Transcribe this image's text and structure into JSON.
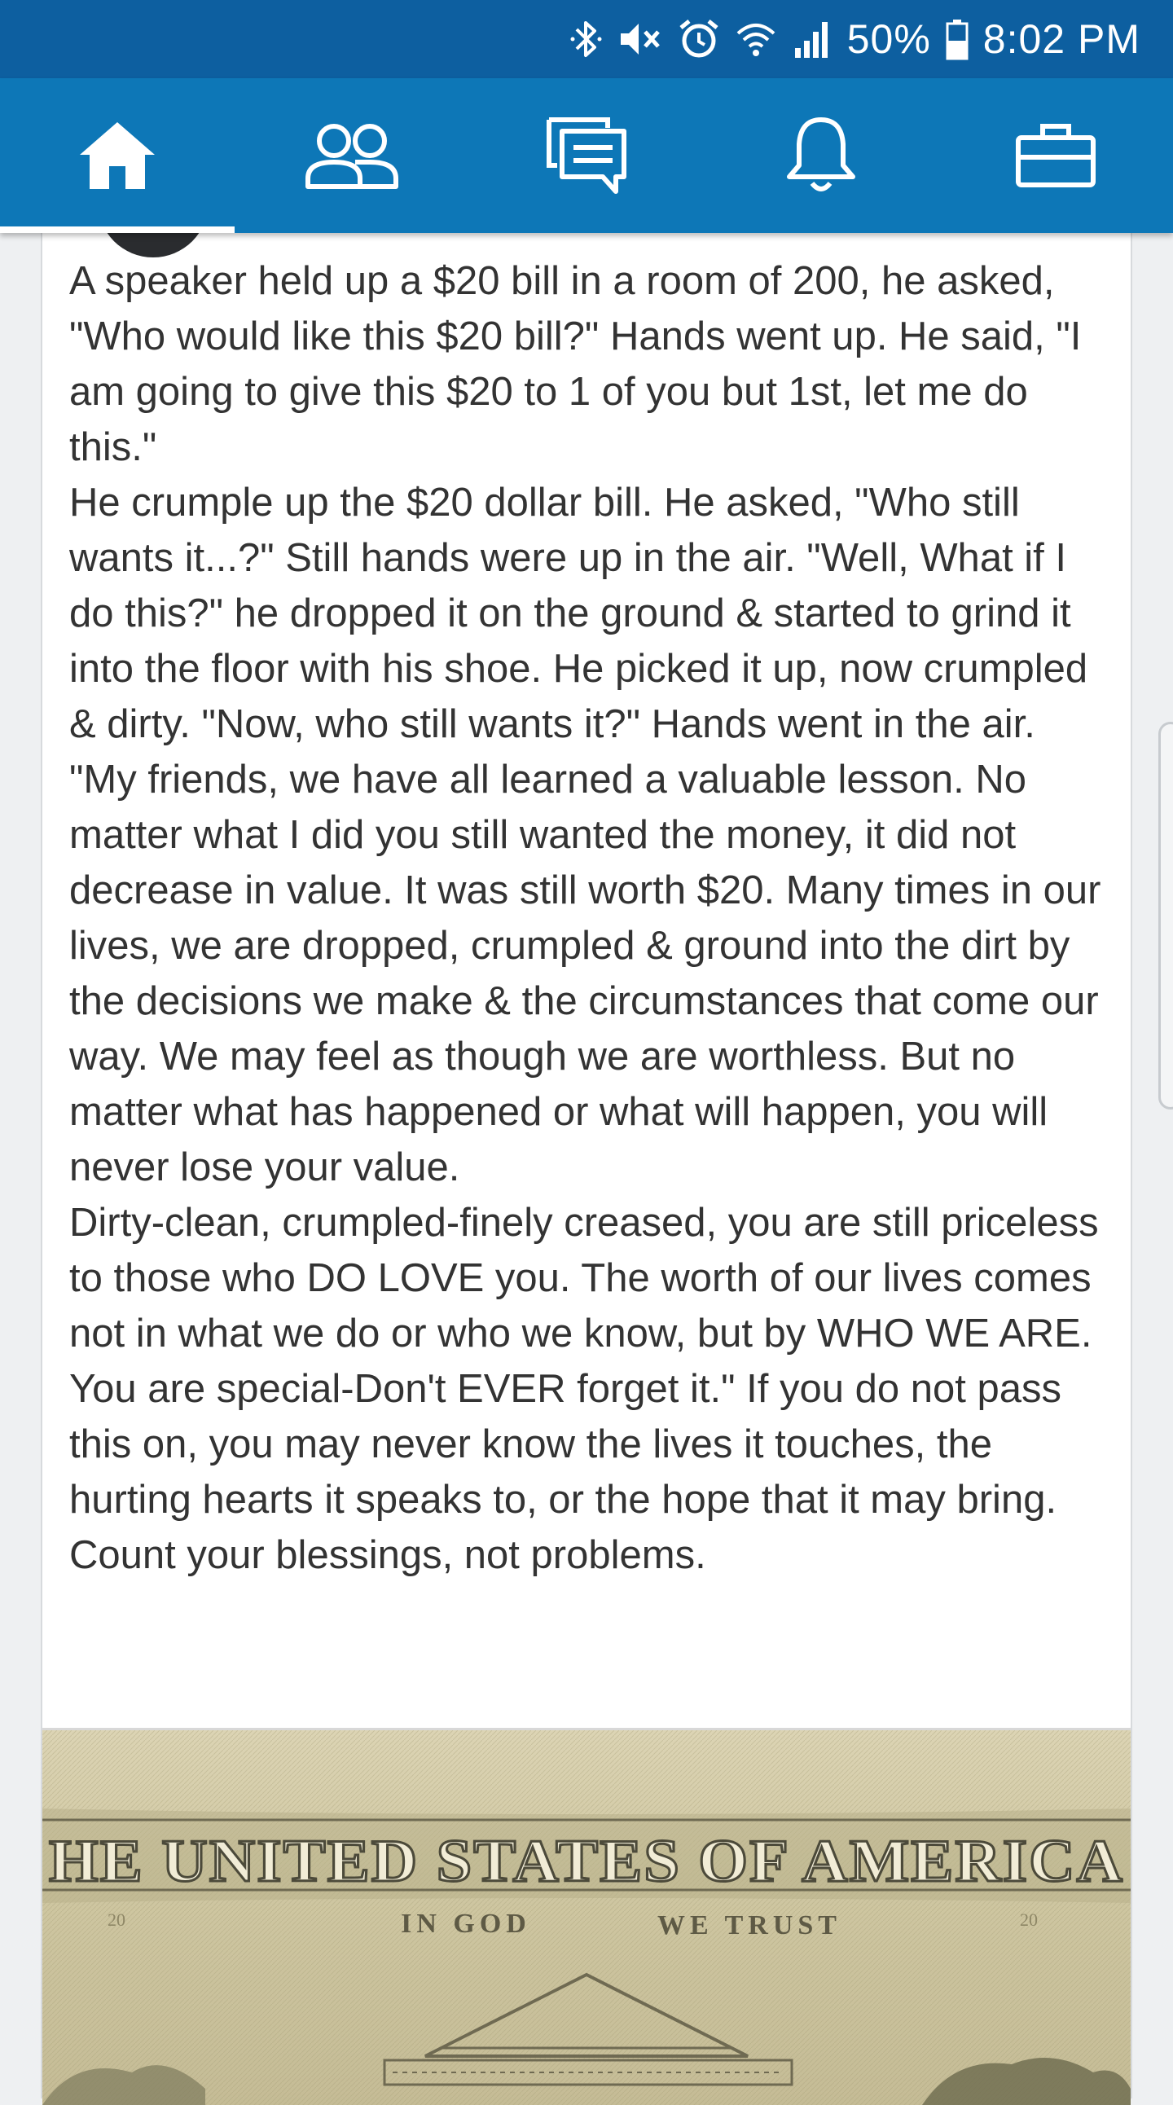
{
  "status_bar": {
    "battery_percent": "50%",
    "time": "8:02 PM",
    "icons": [
      "bluetooth-icon",
      "mute-icon",
      "alarm-icon",
      "wifi-icon",
      "signal-icon",
      "battery-icon"
    ]
  },
  "nav_tabs": [
    {
      "name": "home",
      "icon": "home-icon",
      "active": true
    },
    {
      "name": "network",
      "icon": "people-icon",
      "active": false
    },
    {
      "name": "messaging",
      "icon": "messages-icon",
      "active": false
    },
    {
      "name": "notifications",
      "icon": "bell-icon",
      "active": false
    },
    {
      "name": "jobs",
      "icon": "briefcase-icon",
      "active": false
    }
  ],
  "post": {
    "paragraphs": [
      "A speaker held up a $20 bill in a room of 200, he asked, \"Who would like this $20 bill?\" Hands went up. He said, \"I am going to give this $20 to 1 of you but 1st, let me do this.\"",
      "He crumple up the $20 dollar bill. He asked, \"Who still wants it...?\" Still hands were up in the air. \"Well, What if I do this?\" he dropped it on the ground & started to grind it into the floor with his shoe. He picked it up, now crumpled & dirty. \"Now, who still wants it?\" Hands went in the air.",
      "\"My friends, we have all learned a valuable lesson. No matter what I did you still wanted the money, it did not decrease in value. It was still worth $20. Many times in our lives, we are dropped, crumpled & ground into the dirt by the decisions we make & the circumstances that come our way. We may feel as though we are worthless. But no matter what has happened or what will happen, you will never lose your value.",
      "Dirty-clean, crumpled-finely creased, you are still priceless to those who DO LOVE you. The worth of our lives comes not in what we do or who we know, but by WHO WE ARE.",
      "You are special-Don't EVER forget it.\" If you do not pass this on, you may never know the lives it touches, the hurting hearts it speaks to, or the hope that it may bring. Count your blessings, not problems."
    ],
    "image": {
      "banner_text": "HE UNITED STATES OF AMERICA",
      "motto_left": "IN GOD",
      "motto_right": "WE TRUST"
    }
  },
  "colors": {
    "status_bar": "#0d5fa0",
    "nav_bar": "#0d77b7",
    "text": "#333333"
  }
}
